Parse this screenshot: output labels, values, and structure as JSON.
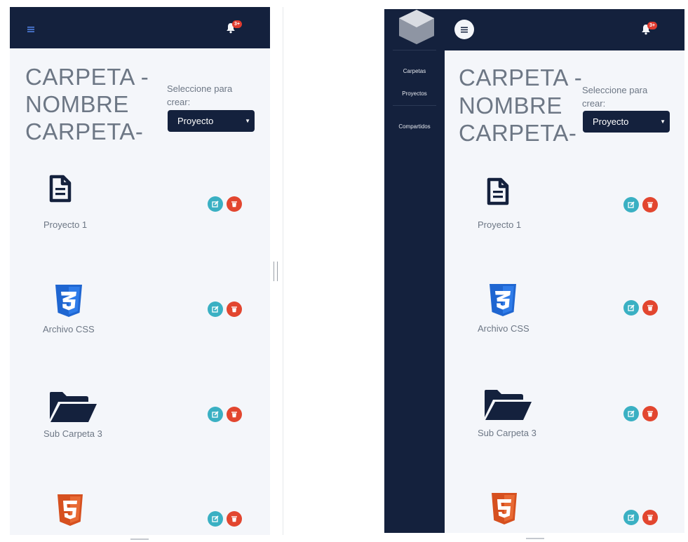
{
  "colors": {
    "navy": "#14213d",
    "background": "#f4f6fa",
    "text_gray": "#6d7785",
    "edit": "#3ab0c3",
    "delete": "#e2462f",
    "badge": "#e03b2f",
    "css_blue": "#1f66d1",
    "html_orange": "#d6501f"
  },
  "header": {
    "menu_icon": "hamburger-icon",
    "bell_icon": "bell-icon",
    "badge": "3+"
  },
  "page": {
    "title": [
      "CARPETA -",
      "NOMBRE",
      "CARPETA-"
    ],
    "create_label_line1": "Seleccione para",
    "create_label_line2": "crear:",
    "create_select_value": "Proyecto",
    "create_select_caret": "▼"
  },
  "items": [
    {
      "label": "Proyecto 1",
      "icon": "document-icon"
    },
    {
      "label": "Archivo CSS",
      "icon": "css3-icon"
    },
    {
      "label": "Sub Carpeta 3",
      "icon": "folder-open-icon"
    },
    {
      "label": "",
      "icon": "html5-icon"
    }
  ],
  "item_actions": {
    "edit_icon": "edit-icon",
    "delete_icon": "trash-icon"
  },
  "sidebar": {
    "logo": "logo-icon",
    "items": [
      "Carpetas",
      "Proyectos",
      "Compartidos"
    ]
  }
}
